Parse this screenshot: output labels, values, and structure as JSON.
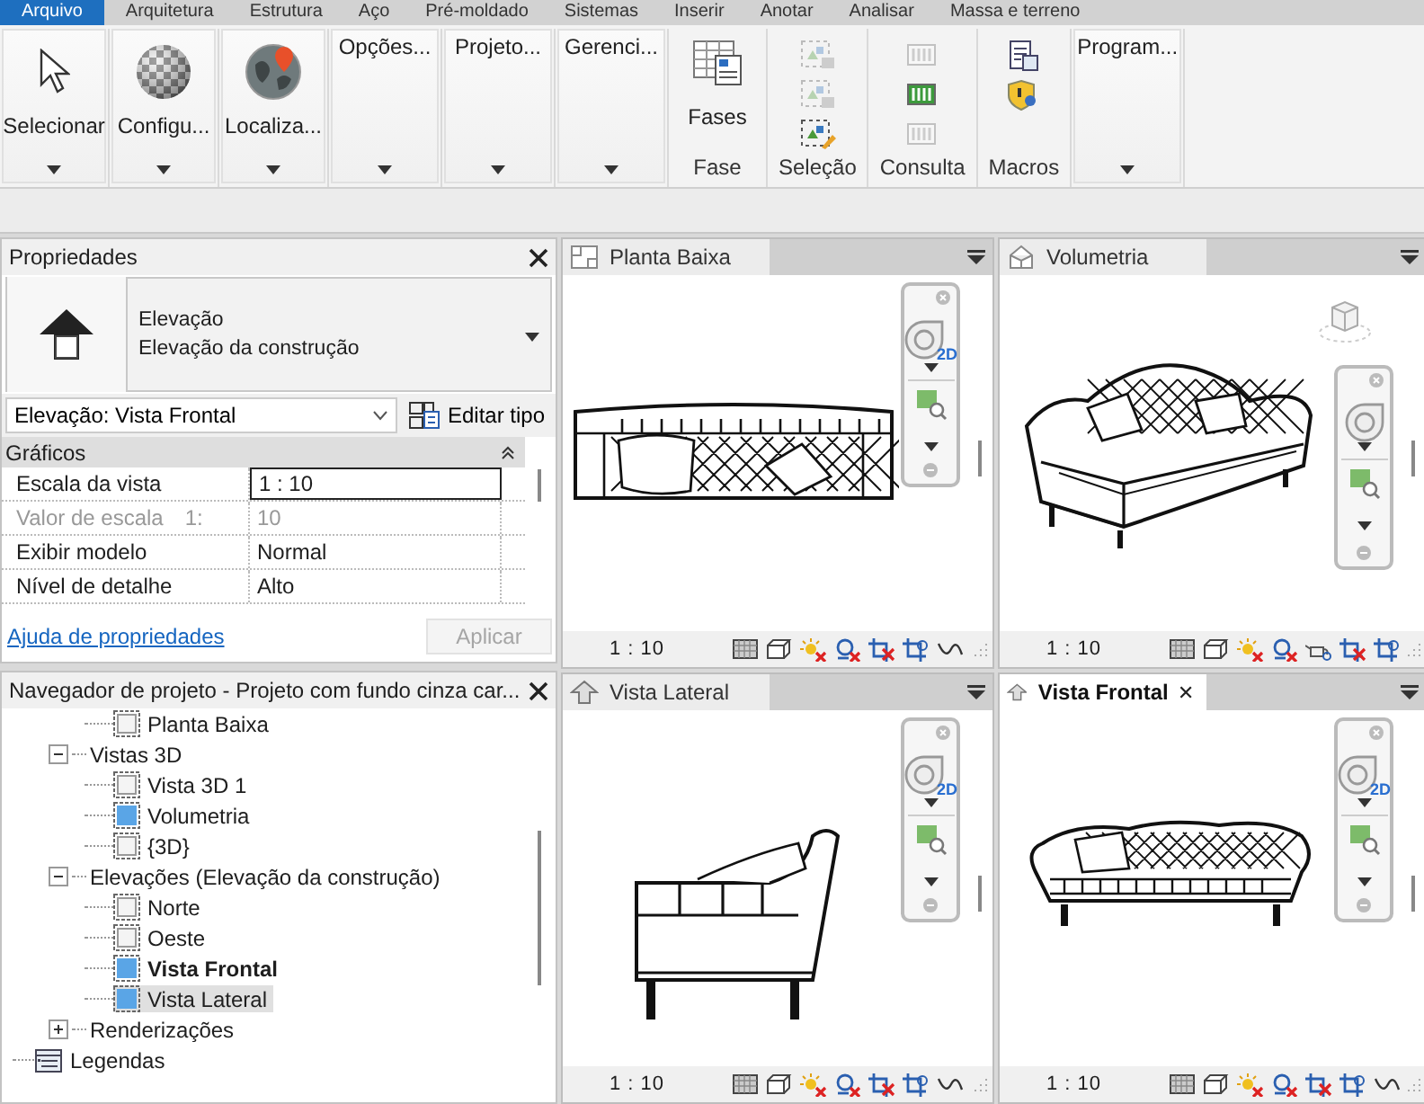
{
  "ribbon_tabs": [
    {
      "label": "Arquivo",
      "selected": true
    },
    {
      "label": "Arquitetura",
      "selected": false
    },
    {
      "label": "Estrutura",
      "selected": false
    },
    {
      "label": "Aço",
      "selected": false
    },
    {
      "label": "Pré-moldado",
      "selected": false
    },
    {
      "label": "Sistemas",
      "selected": false
    },
    {
      "label": "Inserir",
      "selected": false
    },
    {
      "label": "Anotar",
      "selected": false
    },
    {
      "label": "Analisar",
      "selected": false
    },
    {
      "label": "Massa e terreno",
      "selected": false
    }
  ],
  "ribbon_panels": [
    {
      "kind": "tool",
      "label": "Selecionar"
    },
    {
      "kind": "tool",
      "label": "Configu..."
    },
    {
      "kind": "tool",
      "label": "Localiza..."
    },
    {
      "kind": "collapsed",
      "label": "Opções..."
    },
    {
      "kind": "collapsed",
      "label": "Projeto..."
    },
    {
      "kind": "collapsed",
      "label": "Gerenci..."
    },
    {
      "kind": "large",
      "button": "Fases",
      "label": "Fase"
    },
    {
      "kind": "icons",
      "label": "Seleção",
      "tools": [
        {
          "disabled": true
        },
        {
          "disabled": true
        },
        {
          "disabled": false
        }
      ]
    },
    {
      "kind": "icons",
      "label": "Consulta",
      "tools": [
        {
          "disabled": true
        },
        {
          "disabled": false
        },
        {
          "disabled": true
        }
      ]
    },
    {
      "kind": "icons",
      "label": "Macros",
      "tools": [
        {
          "disabled": false
        },
        {
          "disabled": false
        }
      ]
    },
    {
      "kind": "collapsed",
      "label": "Program..."
    }
  ],
  "properties": {
    "title": "Propriedades",
    "type_name": "Elevação",
    "type_family": "Elevação da construção",
    "selector": "Elevação: Vista Frontal",
    "edit_type": "Editar tipo",
    "group": "Gráficos",
    "rows": [
      {
        "name": "Escala da vista",
        "value": "1 : 10",
        "selected": true,
        "disabled": false
      },
      {
        "name": "Valor de escala",
        "unit": "1:",
        "value": "10",
        "selected": false,
        "disabled": true
      },
      {
        "name": "Exibir modelo",
        "value": "Normal",
        "selected": false,
        "disabled": false
      },
      {
        "name": "Nível de detalhe",
        "value": "Alto",
        "selected": false,
        "disabled": false
      }
    ],
    "help_link": "Ajuda de propriedades",
    "apply": {
      "label": "Aplicar",
      "disabled": true
    }
  },
  "project_browser": {
    "title": "Navegador de projeto - Projeto com fundo cinza car...",
    "tree": [
      {
        "children": [
          {
            "children": [
              {
                "label": "Planta Baixa",
                "open": false,
                "active": false,
                "selected": false
              }
            ]
          },
          {
            "label": "Vistas 3D",
            "expanded": true,
            "children": [
              {
                "label": "Vista 3D 1",
                "open": false,
                "active": false,
                "selected": false
              },
              {
                "label": "Volumetria",
                "open": true,
                "active": false,
                "selected": false
              },
              {
                "label": "{3D}",
                "open": false,
                "active": false,
                "selected": false
              }
            ]
          },
          {
            "label": "Elevações (Elevação da construção)",
            "expanded": true,
            "children": [
              {
                "label": "Norte",
                "open": false,
                "active": false,
                "selected": false
              },
              {
                "label": "Oeste",
                "open": false,
                "active": false,
                "selected": false
              },
              {
                "label": "Vista Frontal",
                "open": true,
                "active": true,
                "selected": false
              },
              {
                "label": "Vista Lateral",
                "open": true,
                "active": false,
                "selected": true
              }
            ]
          },
          {
            "label": "Renderizações",
            "expanded": false
          }
        ]
      },
      {
        "kind": "legend",
        "label": "Legendas"
      }
    ]
  },
  "views": [
    {
      "title": "Planta Baixa",
      "kind": "plan",
      "active": false,
      "wheel_label": "2D",
      "scale": "1 : 10"
    },
    {
      "title": "Volumetria",
      "kind": "perspective",
      "active": false,
      "scale": "1 : 10"
    },
    {
      "title": "Vista Lateral",
      "kind": "elevation",
      "active": false,
      "wheel_label": "2D",
      "scale": "1 : 10"
    },
    {
      "title": "Vista Frontal",
      "kind": "elevation",
      "active": true,
      "wheel_label": "2D",
      "scale": "1 : 10"
    }
  ]
}
